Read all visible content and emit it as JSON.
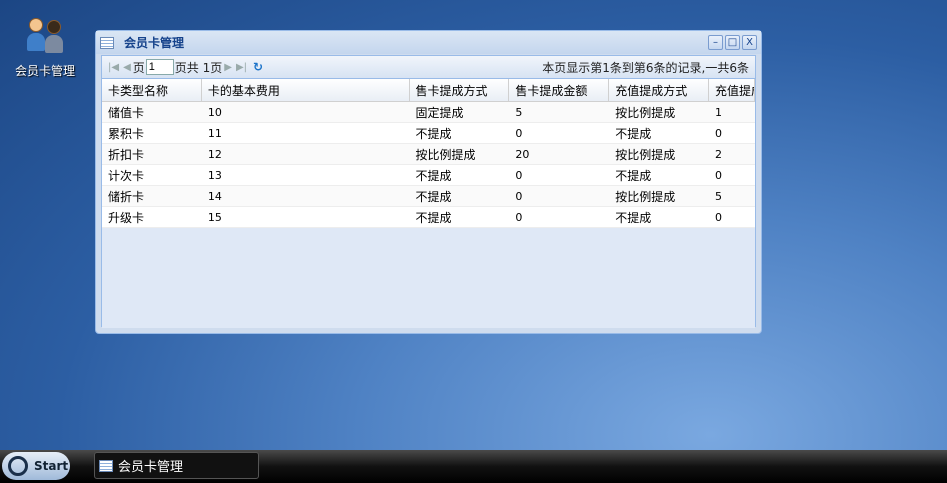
{
  "desktop": {
    "icon_label": "会员卡管理"
  },
  "window": {
    "title": "会员卡管理",
    "minimize": "–",
    "maximize": "□",
    "close": "X"
  },
  "pager": {
    "page_label": "页",
    "page_value": "1",
    "total": "页共 1页",
    "info": "本页显示第1条到第6条的记录,一共6条"
  },
  "grid": {
    "columns": [
      "卡类型名称",
      "卡的基本费用",
      "售卡提成方式",
      "售卡提成金额",
      "充值提成方式",
      "充值提成"
    ],
    "rows": [
      [
        "储值卡",
        "10",
        "固定提成",
        "5",
        "按比例提成",
        "1"
      ],
      [
        "累积卡",
        "11",
        "不提成",
        "0",
        "不提成",
        "0"
      ],
      [
        "折扣卡",
        "12",
        "按比例提成",
        "20",
        "按比例提成",
        "2"
      ],
      [
        "计次卡",
        "13",
        "不提成",
        "0",
        "不提成",
        "0"
      ],
      [
        "储折卡",
        "14",
        "不提成",
        "0",
        "按比例提成",
        "5"
      ],
      [
        "升级卡",
        "15",
        "不提成",
        "0",
        "不提成",
        "0"
      ]
    ]
  },
  "taskbar": {
    "start": "Start",
    "task": "会员卡管理"
  }
}
